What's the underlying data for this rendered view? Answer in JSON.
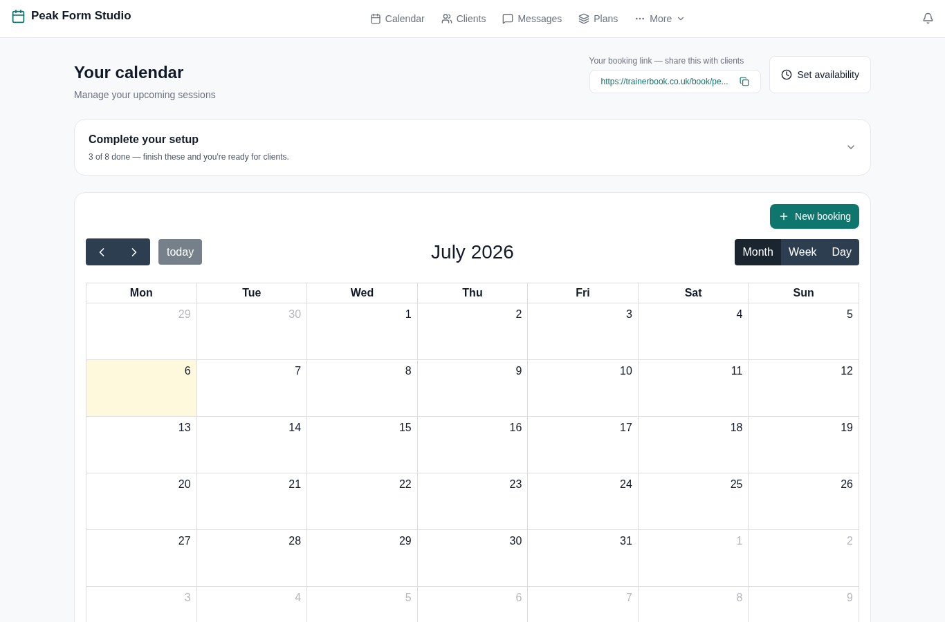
{
  "brand": {
    "name": "Peak Form Studio"
  },
  "nav": [
    {
      "label": "Calendar"
    },
    {
      "label": "Clients"
    },
    {
      "label": "Messages"
    },
    {
      "label": "Plans"
    },
    {
      "label": "More"
    }
  ],
  "page": {
    "title": "Your calendar",
    "subtitle": "Manage your upcoming sessions"
  },
  "booking_link": {
    "label": "Your booking link — share this with clients",
    "value": "https://trainerbook.co.uk/book/pe..."
  },
  "availability_button": "Set availability",
  "setup": {
    "title": "Complete your setup",
    "subtitle": "3 of 8 done — finish these and you're ready for clients.",
    "expanded": false
  },
  "new_booking_button": "New booking",
  "toolbar": {
    "today_button": {
      "label": "today",
      "disabled": true
    },
    "title": "July 2026",
    "views": [
      {
        "label": "Month",
        "selected": true
      },
      {
        "label": "Week",
        "selected": false
      },
      {
        "label": "Day",
        "selected": false
      }
    ]
  },
  "weekdays": [
    "Mon",
    "Tue",
    "Wed",
    "Thu",
    "Fri",
    "Sat",
    "Sun"
  ],
  "weeks": [
    [
      {
        "day": "29",
        "other_month": true,
        "today": false
      },
      {
        "day": "30",
        "other_month": true,
        "today": false
      },
      {
        "day": "1",
        "other_month": false,
        "today": false
      },
      {
        "day": "2",
        "other_month": false,
        "today": false
      },
      {
        "day": "3",
        "other_month": false,
        "today": false
      },
      {
        "day": "4",
        "other_month": false,
        "today": false
      },
      {
        "day": "5",
        "other_month": false,
        "today": false
      }
    ],
    [
      {
        "day": "6",
        "other_month": false,
        "today": true
      },
      {
        "day": "7",
        "other_month": false,
        "today": false
      },
      {
        "day": "8",
        "other_month": false,
        "today": false
      },
      {
        "day": "9",
        "other_month": false,
        "today": false
      },
      {
        "day": "10",
        "other_month": false,
        "today": false
      },
      {
        "day": "11",
        "other_month": false,
        "today": false
      },
      {
        "day": "12",
        "other_month": false,
        "today": false
      }
    ],
    [
      {
        "day": "13",
        "other_month": false,
        "today": false
      },
      {
        "day": "14",
        "other_month": false,
        "today": false
      },
      {
        "day": "15",
        "other_month": false,
        "today": false
      },
      {
        "day": "16",
        "other_month": false,
        "today": false
      },
      {
        "day": "17",
        "other_month": false,
        "today": false
      },
      {
        "day": "18",
        "other_month": false,
        "today": false
      },
      {
        "day": "19",
        "other_month": false,
        "today": false
      }
    ],
    [
      {
        "day": "20",
        "other_month": false,
        "today": false
      },
      {
        "day": "21",
        "other_month": false,
        "today": false
      },
      {
        "day": "22",
        "other_month": false,
        "today": false
      },
      {
        "day": "23",
        "other_month": false,
        "today": false
      },
      {
        "day": "24",
        "other_month": false,
        "today": false
      },
      {
        "day": "25",
        "other_month": false,
        "today": false
      },
      {
        "day": "26",
        "other_month": false,
        "today": false
      }
    ],
    [
      {
        "day": "27",
        "other_month": false,
        "today": false
      },
      {
        "day": "28",
        "other_month": false,
        "today": false
      },
      {
        "day": "29",
        "other_month": false,
        "today": false
      },
      {
        "day": "30",
        "other_month": false,
        "today": false
      },
      {
        "day": "31",
        "other_month": false,
        "today": false
      },
      {
        "day": "1",
        "other_month": true,
        "today": false
      },
      {
        "day": "2",
        "other_month": true,
        "today": false
      }
    ],
    [
      {
        "day": "3",
        "other_month": true,
        "today": false
      },
      {
        "day": "4",
        "other_month": true,
        "today": false
      },
      {
        "day": "5",
        "other_month": true,
        "today": false
      },
      {
        "day": "6",
        "other_month": true,
        "today": false
      },
      {
        "day": "7",
        "other_month": true,
        "today": false
      },
      {
        "day": "8",
        "other_month": true,
        "today": false
      },
      {
        "day": "9",
        "other_month": true,
        "today": false
      }
    ]
  ]
}
